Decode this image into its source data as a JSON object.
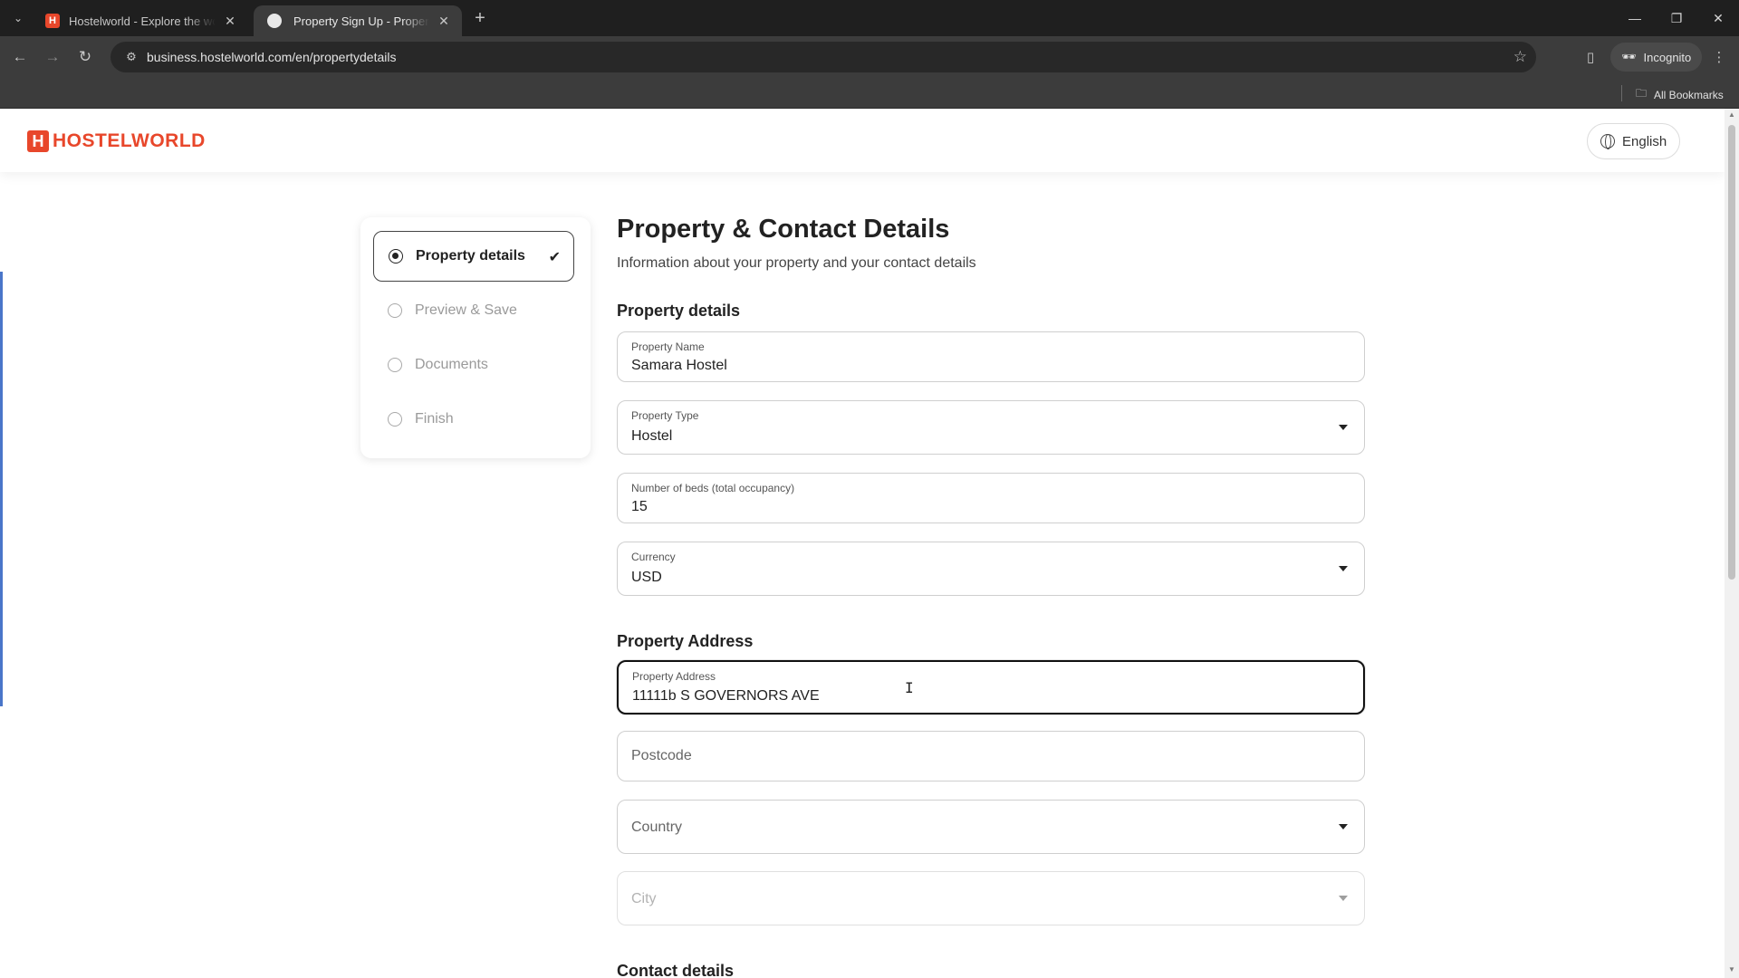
{
  "browser": {
    "tabs": [
      {
        "title": "Hostelworld - Explore the world",
        "active": false
      },
      {
        "title": "Property Sign Up - Property and",
        "active": true
      }
    ],
    "url": "business.hostelworld.com/en/propertydetails",
    "incognito_label": "Incognito",
    "bookmarks_label": "All Bookmarks"
  },
  "header": {
    "logo_text": "HOSTELWORLD",
    "language": "English"
  },
  "steps": [
    {
      "label": "Property details",
      "active": true,
      "done": true
    },
    {
      "label": "Preview & Save",
      "active": false
    },
    {
      "label": "Documents",
      "active": false
    },
    {
      "label": "Finish",
      "active": false
    }
  ],
  "main": {
    "title": "Property & Contact Details",
    "subtitle": "Information about your property and your contact details",
    "property_section": "Property details",
    "address_section": "Property Address",
    "contact_section": "Contact details",
    "fields": {
      "property_name": {
        "label": "Property Name",
        "value": "Samara Hostel"
      },
      "property_type": {
        "label": "Property Type",
        "value": "Hostel"
      },
      "beds": {
        "label": "Number of beds (total occupancy)",
        "value": "15"
      },
      "currency": {
        "label": "Currency",
        "value": "USD"
      },
      "address": {
        "label": "Property Address",
        "value": "11111b S GOVERNORS AVE"
      },
      "postcode": {
        "placeholder": "Postcode"
      },
      "country": {
        "placeholder": "Country"
      },
      "city": {
        "placeholder": "City"
      }
    }
  },
  "colors": {
    "brand": "#e8472b",
    "accent_left": "#4a76c9",
    "chrome_dark": "#1f1f1f",
    "chrome_toolbar": "#3c3c3c"
  }
}
